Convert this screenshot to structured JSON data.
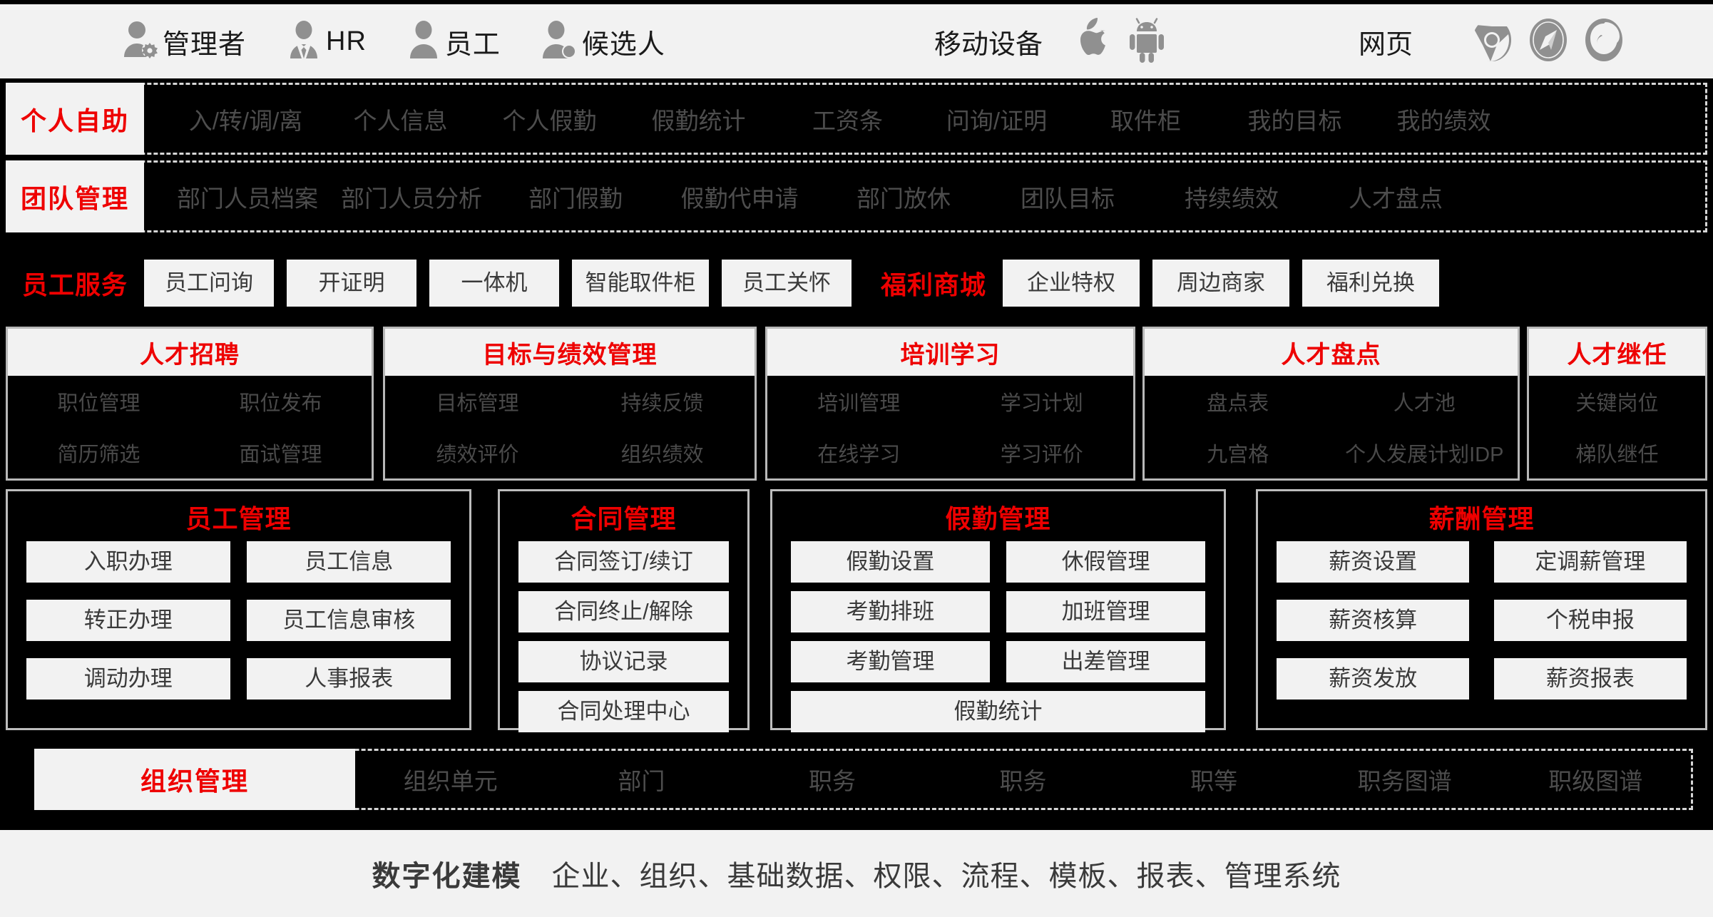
{
  "header": {
    "personas": [
      {
        "label": "管理者",
        "icon": "user-gear-icon"
      },
      {
        "label": "HR",
        "icon": "user-tie-icon"
      },
      {
        "label": "员工",
        "icon": "user-icon"
      },
      {
        "label": "候选人",
        "icon": "user-plus-icon"
      }
    ],
    "mobile_label": "移动设备",
    "mobile_icons": [
      "apple-icon",
      "android-icon"
    ],
    "web_label": "网页",
    "web_icons": [
      "chrome-icon",
      "safari-icon",
      "firefox-icon"
    ]
  },
  "self_service": {
    "title": "个人自助",
    "items": [
      "入/转/调/离",
      "个人信息",
      "个人假勤",
      "假勤统计",
      "工资条",
      "问询/证明",
      "取件柜",
      "我的目标",
      "我的绩效"
    ]
  },
  "team_management": {
    "title": "团队管理",
    "items": [
      "部门人员档案",
      "部门人员分析",
      "部门假勤",
      "假勤代申请",
      "部门放休",
      "团队目标",
      "持续绩效",
      "人才盘点"
    ]
  },
  "employee_service": {
    "title": "员工服务",
    "items": [
      "员工问询",
      "开证明",
      "一体机",
      "智能取件柜",
      "员工关怀"
    ],
    "mall_title": "福利商城",
    "mall_items": [
      "企业特权",
      "周边商家",
      "福利兑换"
    ]
  },
  "modules": [
    {
      "title": "人才招聘",
      "subs": [
        "职位管理",
        "职位发布",
        "简历筛选",
        "面试管理"
      ]
    },
    {
      "title": "目标与绩效管理",
      "subs": [
        "目标管理",
        "持续反馈",
        "绩效评价",
        "组织绩效"
      ]
    },
    {
      "title": "培训学习",
      "subs": [
        "培训管理",
        "学习计划",
        "在线学习",
        "学习评价"
      ]
    },
    {
      "title": "人才盘点",
      "subs": [
        "盘点表",
        "人才池",
        "九宫格",
        "个人发展计划IDP"
      ]
    },
    {
      "title": "人才继任",
      "subs": [
        "关键岗位",
        "梯队继任"
      ]
    }
  ],
  "big_modules": {
    "employee": {
      "title": "员工管理",
      "buttons": [
        "入职办理",
        "员工信息",
        "转正办理",
        "员工信息审核",
        "调动办理",
        "人事报表"
      ]
    },
    "contract": {
      "title": "合同管理",
      "buttons": [
        "合同签订/续订",
        "合同终止/解除",
        "协议记录",
        "合同处理中心"
      ]
    },
    "attendance": {
      "title": "假勤管理",
      "buttons": [
        "假勤设置",
        "休假管理",
        "考勤排班",
        "加班管理",
        "考勤管理",
        "出差管理"
      ],
      "full_button": "假勤统计"
    },
    "payroll": {
      "title": "薪酬管理",
      "buttons": [
        "薪资设置",
        "定调薪管理",
        "薪资核算",
        "个税申报",
        "薪资发放",
        "薪资报表"
      ]
    }
  },
  "organization": {
    "title": "组织管理",
    "items": [
      "组织单元",
      "部门",
      "职务",
      "职务",
      "职等",
      "职务图谱",
      "职级图谱"
    ]
  },
  "footer": {
    "strong": "数字化建模",
    "text": "企业、组织、基础数据、权限、流程、模板、报表、管理系统"
  },
  "colors": {
    "accent_red": "#ee0000",
    "panel_light": "#f2f2f2",
    "background_dark": "#000000",
    "muted_text": "#4d4d4d"
  }
}
